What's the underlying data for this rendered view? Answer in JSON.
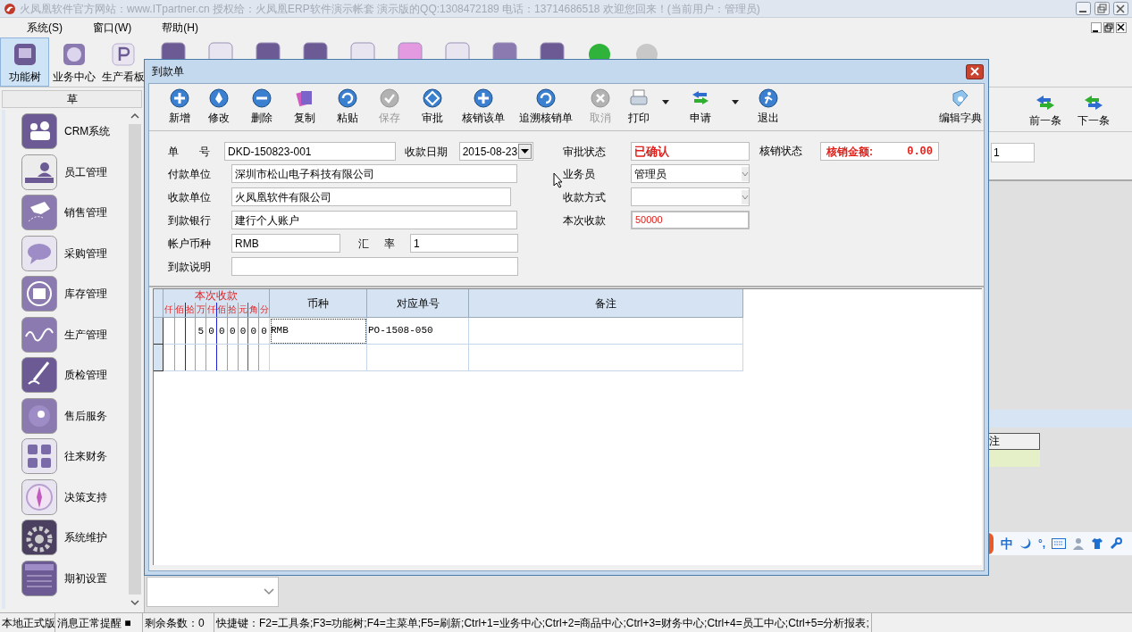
{
  "app": {
    "title": "火凤凰软件官方网站：www.ITpartner.cn  授权给：火凤凰ERP软件演示帐套 演示版的QQ:1308472189  电话：13714686518  欢迎您回来！(当前用户：管理员)",
    "menu": [
      "系统(S)",
      "窗口(W)",
      "帮助(H)"
    ],
    "toolbar": [
      {
        "label": "功能树",
        "selected": true
      },
      {
        "label": "业务中心",
        "selected": false
      },
      {
        "label": "生产看板",
        "selected": false
      }
    ],
    "sidebar": {
      "header": "草",
      "items": [
        "CRM系统",
        "员工管理",
        "销售管理",
        "采购管理",
        "库存管理",
        "生产管理",
        "质检管理",
        "售后服务",
        "往来财务",
        "决策支持",
        "系统维护",
        "期初设置"
      ]
    },
    "nav_buttons": [
      "前一条",
      "下一条"
    ],
    "back_field": {
      "value": "1"
    },
    "back_table": {
      "column": "注"
    },
    "status_bar": [
      "本地正式版",
      "消息正常提醒 ■",
      "剩余条数：0",
      "快捷键：F2=工具条;F3=功能树;F4=主菜单;F5=刷新;Ctrl+1=业务中心;Ctrl+2=商品中心;Ctrl+3=财务中心;Ctrl+4=员工中心;Ctrl+5=分析报表;"
    ],
    "ime": [
      "中",
      "°,"
    ]
  },
  "dialog": {
    "title": "到款单",
    "tools": [
      {
        "label": "新增",
        "disabled": false,
        "dropdown": false
      },
      {
        "label": "修改",
        "disabled": false,
        "dropdown": false
      },
      {
        "label": "删除",
        "disabled": false,
        "dropdown": false
      },
      {
        "label": "复制",
        "disabled": false,
        "dropdown": false
      },
      {
        "label": "粘贴",
        "disabled": false,
        "dropdown": false
      },
      {
        "label": "保存",
        "disabled": true,
        "dropdown": false
      },
      {
        "label": "审批",
        "disabled": false,
        "dropdown": false
      },
      {
        "label": "核销该单",
        "disabled": false,
        "dropdown": false
      },
      {
        "label": "追溯核销单",
        "disabled": false,
        "dropdown": false
      },
      {
        "label": "取消",
        "disabled": true,
        "dropdown": false
      },
      {
        "label": "打印",
        "disabled": false,
        "dropdown": true
      },
      {
        "label": "申请",
        "disabled": false,
        "dropdown": true
      },
      {
        "label": "退出",
        "disabled": false,
        "dropdown": false
      }
    ],
    "dictionary_button": "编辑字典",
    "form_left": [
      {
        "fields": [
          {
            "label": "单 号",
            "value": "DKD-150823-001",
            "kind": "text"
          },
          {
            "label": "收款日期",
            "value": "2015-08-23",
            "kind": "date"
          }
        ]
      },
      {
        "fields": [
          {
            "label": "付款单位",
            "value": "深圳市松山电子科技有限公司",
            "kind": "text"
          }
        ]
      },
      {
        "fields": [
          {
            "label": "收款单位",
            "value": "火凤凰软件有限公司",
            "kind": "text"
          }
        ]
      },
      {
        "fields": [
          {
            "label": "到款银行",
            "value": "建行个人账户",
            "kind": "text"
          }
        ]
      },
      {
        "fields": [
          {
            "label": "帐户币种",
            "value": "RMB",
            "kind": "text"
          },
          {
            "label": "汇 率",
            "value": "1",
            "kind": "text"
          }
        ]
      },
      {
        "fields": [
          {
            "label": "到款说明",
            "kind": "text"
          }
        ]
      }
    ],
    "form_right": [
      {
        "label": "审批状态",
        "value": "已确认",
        "kind": "status"
      },
      {
        "label": "业务员",
        "value": "管理员",
        "kind": "select"
      },
      {
        "label": "收款方式",
        "kind": "select"
      },
      {
        "label": "本次收款",
        "value": "50000",
        "kind": "amount"
      }
    ],
    "settlement": {
      "label": "核销状态",
      "caption": "核销金额:",
      "amount": "0.00"
    },
    "grid": {
      "amount_header": "本次收款",
      "digit_labels": [
        "仟",
        "佰",
        "拾",
        "万",
        "仟",
        "佰",
        "拾",
        "元",
        "角",
        "分"
      ],
      "columns": [
        "币种",
        "对应单号",
        "备注"
      ],
      "rows": [
        {
          "amount_digits": [
            "5",
            "0",
            "0",
            "0",
            "0",
            "0",
            "0"
          ],
          "currency": "RMB",
          "order_no": "PO-1508-050",
          "focused": true
        }
      ]
    }
  }
}
